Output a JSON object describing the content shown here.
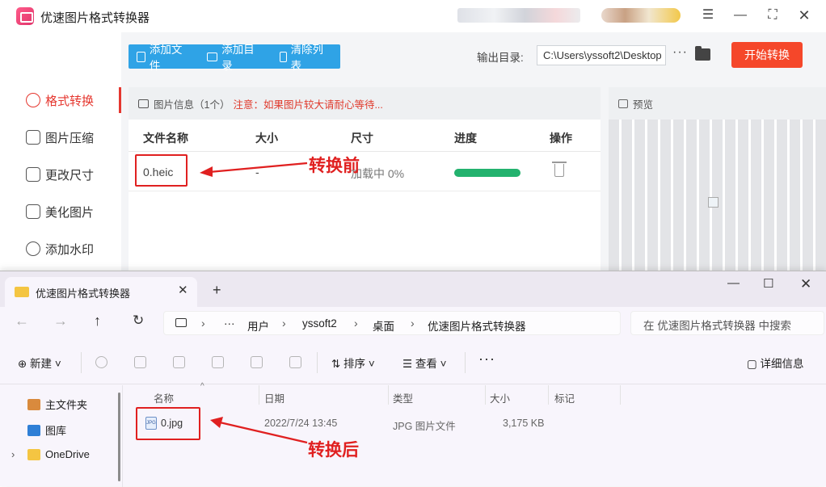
{
  "app": {
    "title": "优速图片格式转换器",
    "window_controls": {
      "menu": "☰",
      "minimize": "—",
      "maximize": "⛶",
      "close": "✕"
    }
  },
  "sidebar": {
    "items": [
      {
        "label": "格式转换",
        "icon": "convert-icon",
        "active": true
      },
      {
        "label": "图片压缩",
        "icon": "compress-icon",
        "active": false
      },
      {
        "label": "更改尺寸",
        "icon": "resize-icon",
        "active": false
      },
      {
        "label": "美化图片",
        "icon": "beautify-icon",
        "active": false
      },
      {
        "label": "添加水印",
        "icon": "watermark-icon",
        "active": false
      }
    ]
  },
  "toolbar": {
    "add_file": "添加文件",
    "add_dir": "添加目录",
    "clear_list": "清除列表",
    "output_label": "输出目录:",
    "output_path": "C:\\Users\\yssoft2\\Desktop",
    "more": "···",
    "start": "开始转换"
  },
  "file_list": {
    "info_title": "图片信息（1个）",
    "info_warning": "注意：如果图片较大请耐心等待...",
    "columns": [
      "文件名称",
      "大小",
      "尺寸",
      "进度",
      "操作"
    ],
    "rows": [
      {
        "name": "0.heic",
        "size": "-",
        "dimensions": "加载中 0%",
        "progress": 1.0
      }
    ]
  },
  "preview": {
    "title": "预览"
  },
  "explorer": {
    "tab_title": "优速图片格式转换器",
    "tab_close": "✕",
    "new_tab": "+",
    "controls": {
      "minimize": "—",
      "maximize": "☐",
      "close": "✕"
    },
    "nav": {
      "back": "←",
      "forward": "→",
      "up": "↑",
      "refresh": "↻"
    },
    "breadcrumbs": [
      "···",
      "用户",
      "yssoft2",
      "桌面",
      "优速图片格式转换器"
    ],
    "crumb_sep": "›",
    "search_placeholder": "在 优速图片格式转换器 中搜索",
    "toolbar": {
      "new": "⊕  新建 ˅",
      "sort": "⇅  排序 ˅",
      "view": "☰  查看 ˅",
      "more": "···",
      "details": "▢  详细信息"
    },
    "nav_pane": [
      {
        "label": "主文件夹",
        "icon": "home-icon"
      },
      {
        "label": "图库",
        "icon": "gallery-icon"
      },
      {
        "label": "OneDrive",
        "icon": "onedrive-folder-icon",
        "expand": "›"
      }
    ],
    "columns": [
      "名称",
      "日期",
      "类型",
      "大小",
      "标记"
    ],
    "sort_arrow": "^",
    "files": [
      {
        "name": "0.jpg",
        "date": "2022/7/24 13:45",
        "type": "JPG 图片文件",
        "size": "3,175 KB",
        "icon_text": "JPG"
      }
    ]
  },
  "annotations": {
    "before": "转换前",
    "after": "转换后",
    "color": "#e02020"
  },
  "colors": {
    "accent_red": "#f5472a",
    "toolbar_blue": "#2fa3e6",
    "progress_green": "#23b26e"
  }
}
